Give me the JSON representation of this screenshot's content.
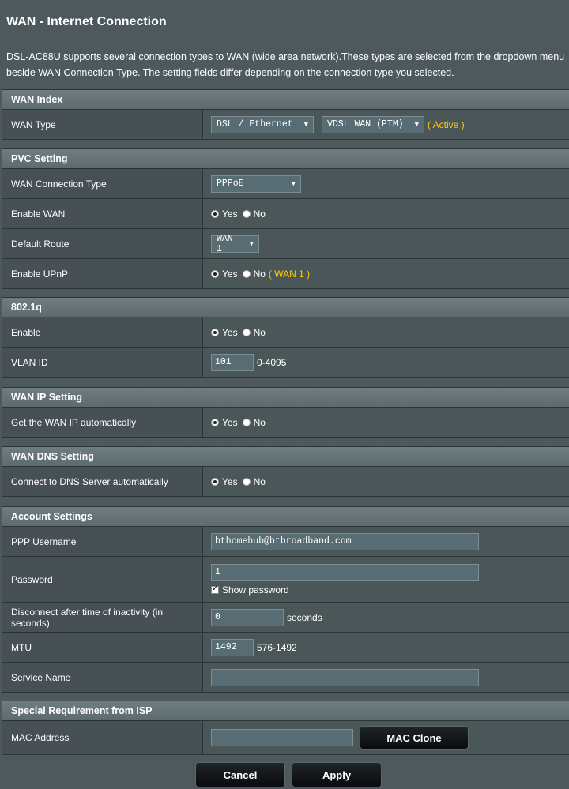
{
  "title": "WAN - Internet Connection",
  "intro": "DSL-AC88U supports several connection types to WAN (wide area network).These types are selected from the dropdown menu beside WAN Connection Type. The setting fields differ depending on the connection type you selected.",
  "wan_index": {
    "heading": "WAN Index",
    "wan_type_label": "WAN Type",
    "wan_type_value": "DSL / Ethernet",
    "wan_mode_value": "VDSL WAN (PTM)",
    "status": "( Active )"
  },
  "pvc": {
    "heading": "PVC Setting",
    "conn_type_label": "WAN Connection Type",
    "conn_type_value": "PPPoE",
    "enable_wan_label": "Enable WAN",
    "default_route_label": "Default Route",
    "default_route_value": "WAN 1",
    "upnp_label": "Enable UPnP",
    "upnp_hint": "( WAN 1 )"
  },
  "vlan": {
    "heading": "802.1q",
    "enable_label": "Enable",
    "vlan_id_label": "VLAN ID",
    "vlan_id_value": "101",
    "vlan_range": "0-4095"
  },
  "wan_ip": {
    "heading": "WAN IP Setting",
    "auto_label": "Get the WAN IP automatically"
  },
  "wan_dns": {
    "heading": "WAN DNS Setting",
    "auto_label": "Connect to DNS Server automatically"
  },
  "account": {
    "heading": "Account Settings",
    "username_label": "PPP Username",
    "username_value": "bthomehub@btbroadband.com",
    "password_label": "Password",
    "password_value": "1",
    "show_password_label": "Show password",
    "idle_label": "Disconnect after time of inactivity (in seconds)",
    "idle_value": "0",
    "idle_unit": "seconds",
    "mtu_label": "MTU",
    "mtu_value": "1492",
    "mtu_range": "576-1492",
    "service_label": "Service Name",
    "service_value": ""
  },
  "isp": {
    "heading": "Special Requirement from ISP",
    "mac_label": "MAC Address",
    "mac_value": "",
    "mac_clone_label": "MAC Clone"
  },
  "radio": {
    "yes": "Yes",
    "no": "No"
  },
  "buttons": {
    "cancel": "Cancel",
    "apply": "Apply"
  }
}
